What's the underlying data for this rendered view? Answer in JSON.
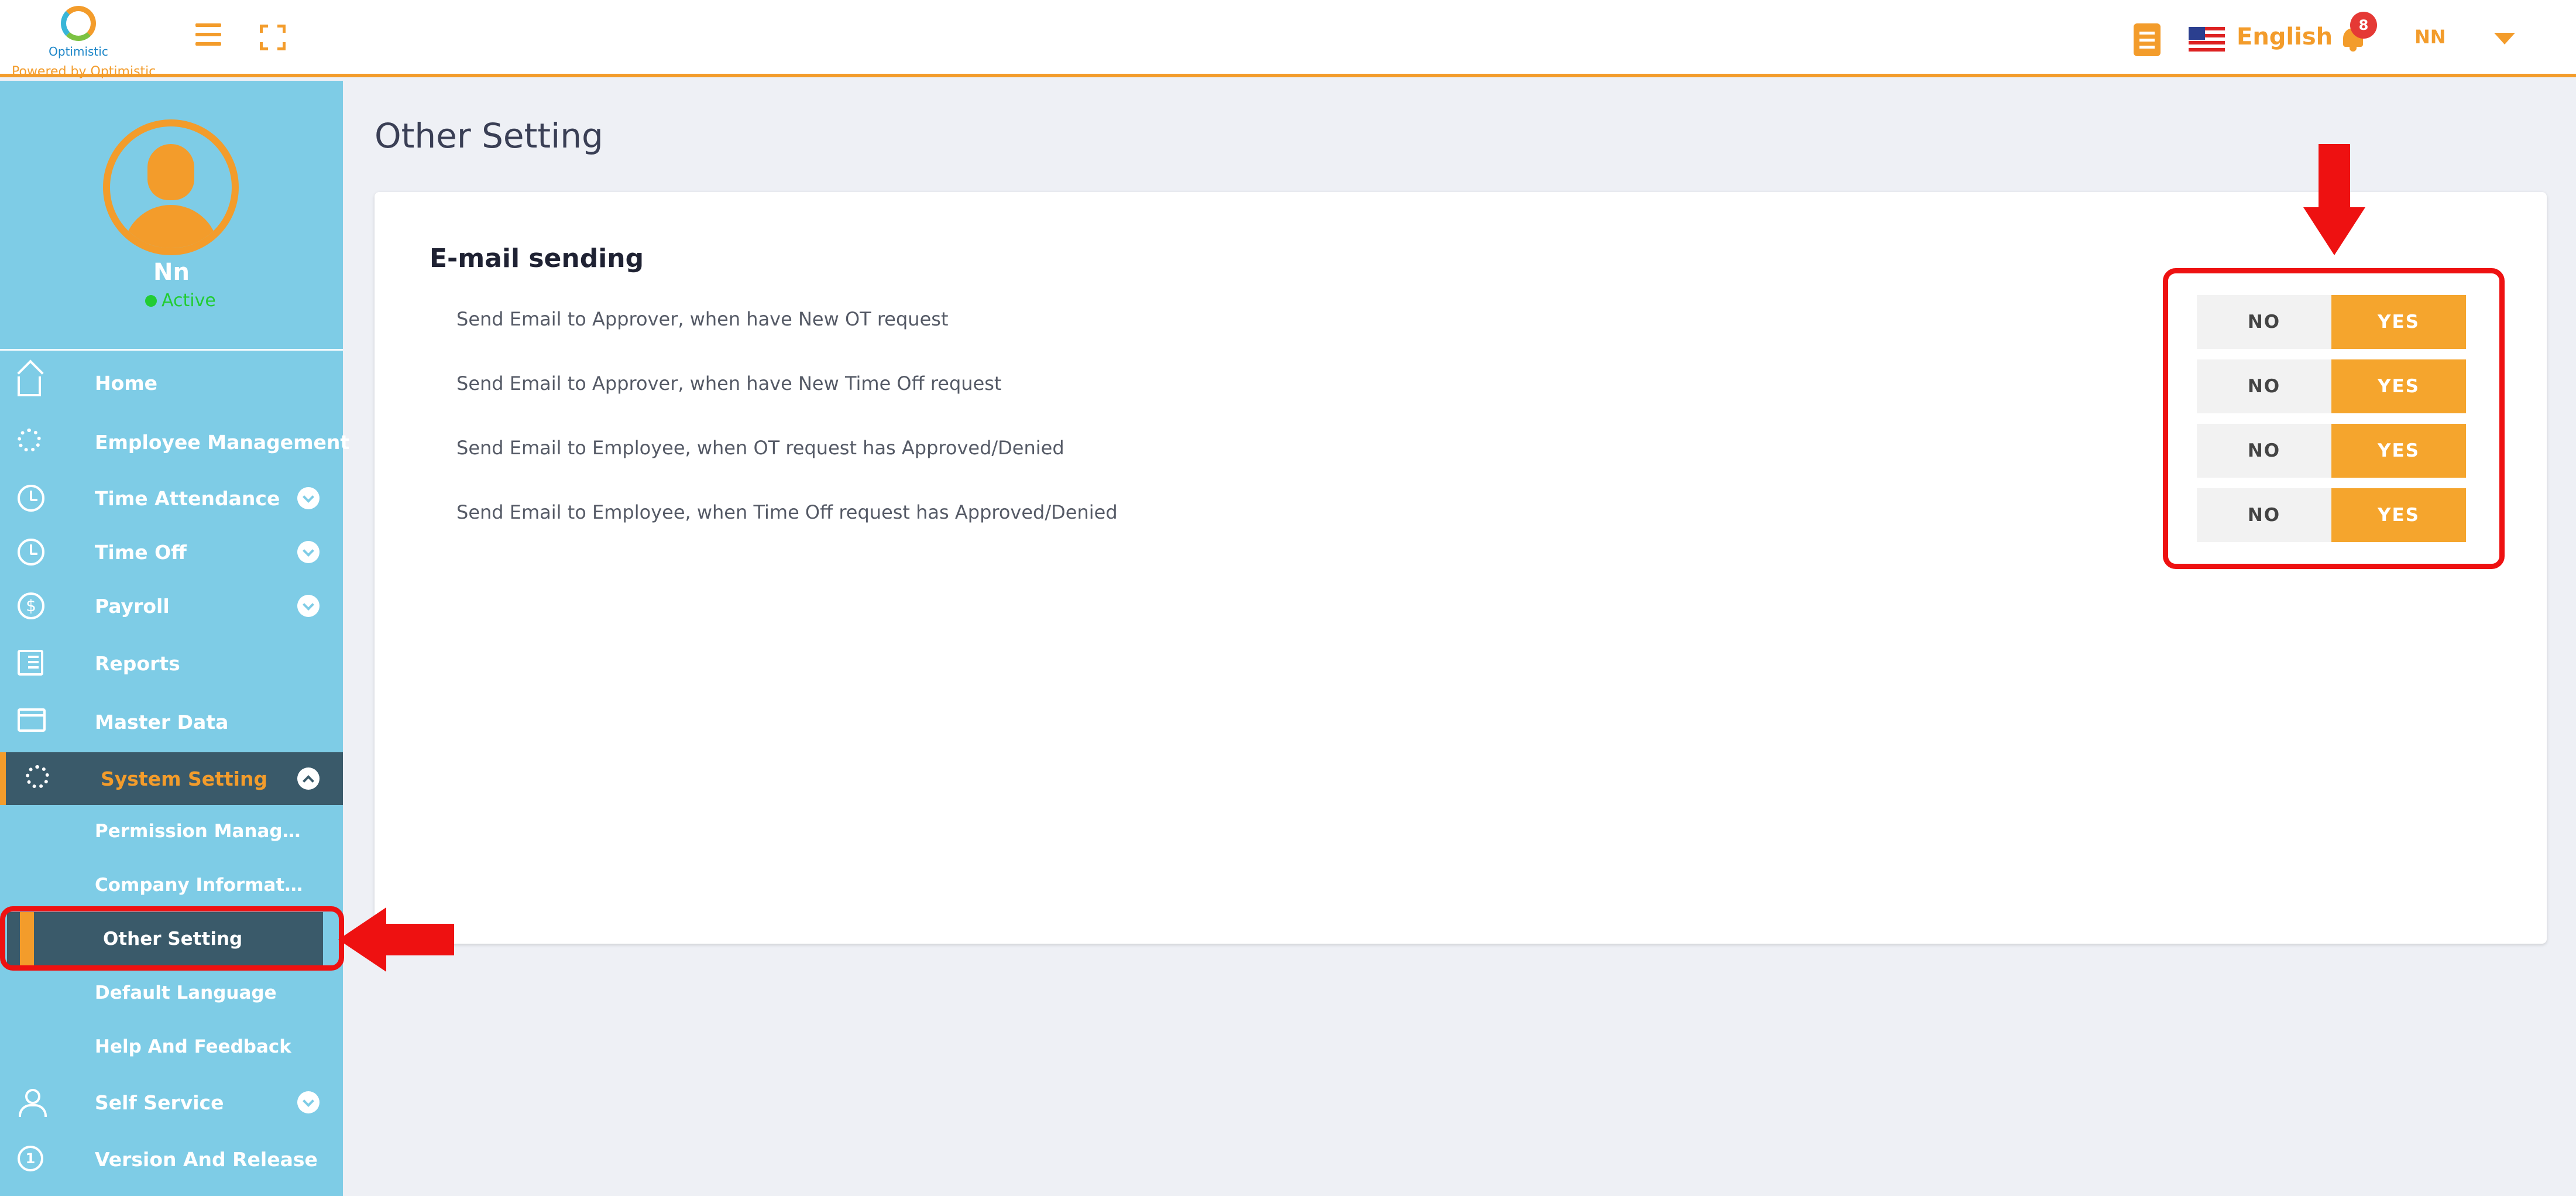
{
  "brand": {
    "name": "Optimistic",
    "powered_by": "Powered by Optimistic"
  },
  "header": {
    "language": "English",
    "notification_count": "8",
    "user_initials": "NN"
  },
  "profile": {
    "name": "Nn",
    "status": "Active"
  },
  "sidebar": {
    "items": [
      {
        "label": "Home",
        "icon": "home-icon"
      },
      {
        "label": "Employee Management",
        "icon": "employee-gears-icon"
      },
      {
        "label": "Time Attendance",
        "icon": "clock-pie-icon",
        "expandable": true
      },
      {
        "label": "Time Off",
        "icon": "clock-icon",
        "expandable": true
      },
      {
        "label": "Payroll",
        "icon": "dollar-icon",
        "expandable": true
      },
      {
        "label": "Reports",
        "icon": "report-icon"
      },
      {
        "label": "Master Data",
        "icon": "master-data-icon"
      },
      {
        "label": "System Setting",
        "icon": "gear-icon",
        "expandable": true,
        "expanded": true,
        "active": true
      },
      {
        "label": "Self Service",
        "icon": "user-icon",
        "expandable": true
      },
      {
        "label": "Version And Release",
        "icon": "version-icon"
      }
    ],
    "system_setting_children": [
      {
        "label": "Permission Manageme..."
      },
      {
        "label": "Company Information"
      },
      {
        "label": "Other Setting",
        "active": true
      },
      {
        "label": "Default Language"
      },
      {
        "label": "Help And Feedback"
      }
    ]
  },
  "main": {
    "page_title": "Other Setting",
    "section_title": "E-mail sending",
    "settings": [
      {
        "label": "Send Email to Approver, when have New OT request",
        "no_label": "NO",
        "yes_label": "YES",
        "value": "YES"
      },
      {
        "label": "Send Email to Approver, when have New Time Off request",
        "no_label": "NO",
        "yes_label": "YES",
        "value": "YES"
      },
      {
        "label": "Send Email to Employee, when OT request has Approved/Denied",
        "no_label": "NO",
        "yes_label": "YES",
        "value": "YES"
      },
      {
        "label": "Send Email to Employee, when Time Off request has Approved/Denied",
        "no_label": "NO",
        "yes_label": "YES",
        "value": "YES"
      }
    ]
  },
  "colors": {
    "accent": "#f39c2b",
    "sidebar_bg": "#7ecce6",
    "sidebar_active": "#3a5a6a",
    "annotation": "#ee1111"
  }
}
